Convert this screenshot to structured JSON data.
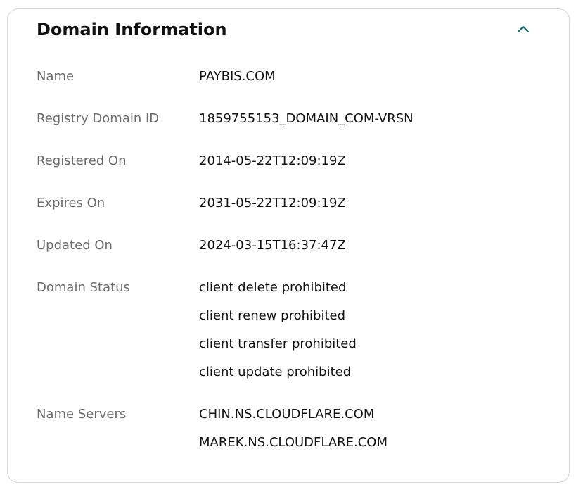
{
  "panel": {
    "title": "Domain Information",
    "collapse_icon": "chevron-up-icon",
    "accent_color": "#0e6a74"
  },
  "fields": {
    "name": {
      "label": "Name",
      "values": [
        "PAYBIS.COM"
      ]
    },
    "registry_domain_id": {
      "label": "Registry Domain ID",
      "values": [
        "1859755153_DOMAIN_COM-VRSN"
      ]
    },
    "registered_on": {
      "label": "Registered On",
      "values": [
        "2014-05-22T12:09:19Z"
      ]
    },
    "expires_on": {
      "label": "Expires On",
      "values": [
        "2031-05-22T12:09:19Z"
      ]
    },
    "updated_on": {
      "label": "Updated On",
      "values": [
        "2024-03-15T16:37:47Z"
      ]
    },
    "domain_status": {
      "label": "Domain Status",
      "values": [
        "client delete prohibited",
        "client renew prohibited",
        "client transfer prohibited",
        "client update prohibited"
      ]
    },
    "name_servers": {
      "label": "Name Servers",
      "values": [
        "CHIN.NS.CLOUDFLARE.COM",
        "MAREK.NS.CLOUDFLARE.COM"
      ]
    }
  }
}
